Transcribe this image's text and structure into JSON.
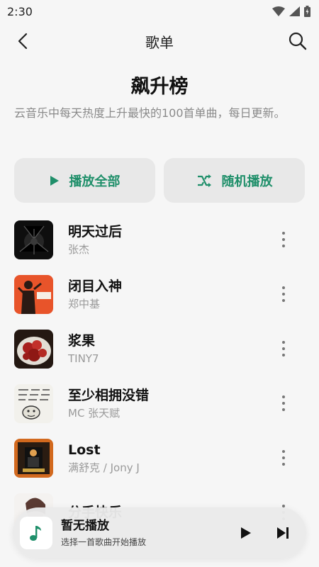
{
  "status_bar": {
    "time": "2:30"
  },
  "app_bar": {
    "title": "歌单"
  },
  "playlist": {
    "title": "飙升榜",
    "description": "云音乐中每天热度上升最快的100首单曲，每日更新。"
  },
  "actions": {
    "play_all": "播放全部",
    "shuffle": "随机播放"
  },
  "accent_color": "#1f8f6a",
  "songs": [
    {
      "title": "明天过后",
      "artist": "张杰"
    },
    {
      "title": "闭目入神",
      "artist": "郑中基"
    },
    {
      "title": "浆果",
      "artist": "TINY7"
    },
    {
      "title": "至少相拥没错",
      "artist": "MC 张天赋"
    },
    {
      "title": "Lost",
      "artist": "满舒克 / Jony J"
    },
    {
      "title": "分手快乐",
      "artist": ""
    }
  ],
  "mini_player": {
    "title": "暂无播放",
    "subtitle": "选择一首歌曲开始播放"
  }
}
